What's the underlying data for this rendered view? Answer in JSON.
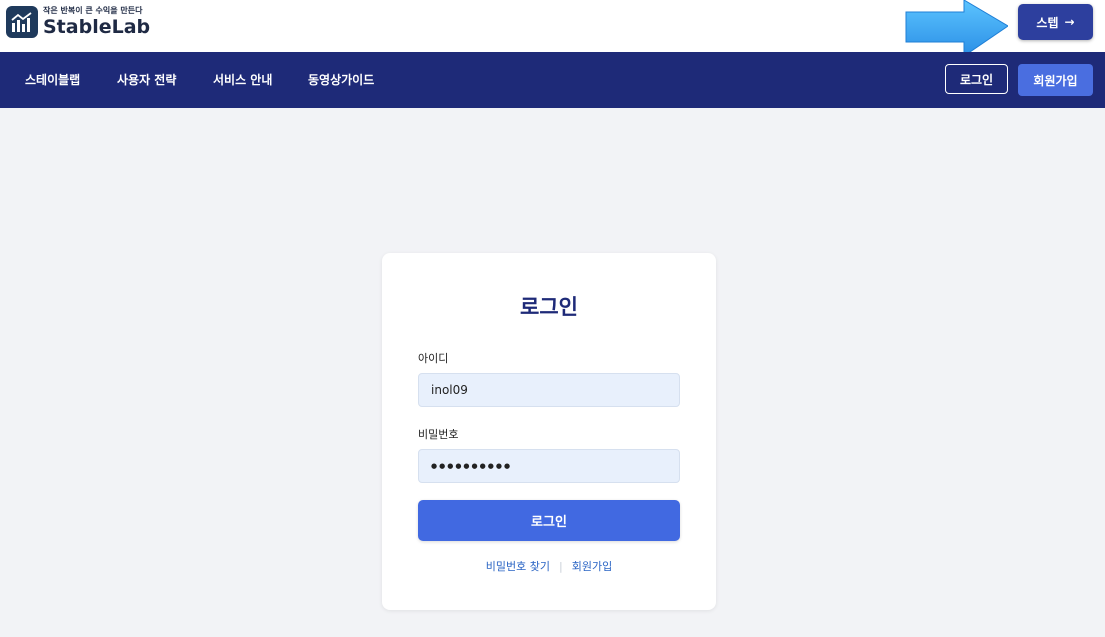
{
  "header": {
    "logo_tagline": "작은 반복이 큰 수익을 만든다",
    "logo_name": "StableLab",
    "step_button": "스텝",
    "step_arrow": "→"
  },
  "nav": {
    "items": [
      "스테이블랩",
      "사용자 전략",
      "서비스 안내",
      "동영상가이드"
    ],
    "login": "로그인",
    "signup": "회원가입"
  },
  "login_form": {
    "title": "로그인",
    "id_label": "아이디",
    "id_value": "inol09",
    "password_label": "비밀번호",
    "password_value": "●●●●●●●●●●",
    "submit": "로그인",
    "find_password": "비밀번호 찾기",
    "separator": "|",
    "signup_link": "회원가입"
  },
  "colors": {
    "brand": "#1e2a78",
    "accent": "#4169e1",
    "annotation_arrow": "#3aa6f0"
  },
  "icons": [
    "stablelab-logo-icon",
    "arrow-right-icon",
    "annotation-arrow-icon"
  ]
}
